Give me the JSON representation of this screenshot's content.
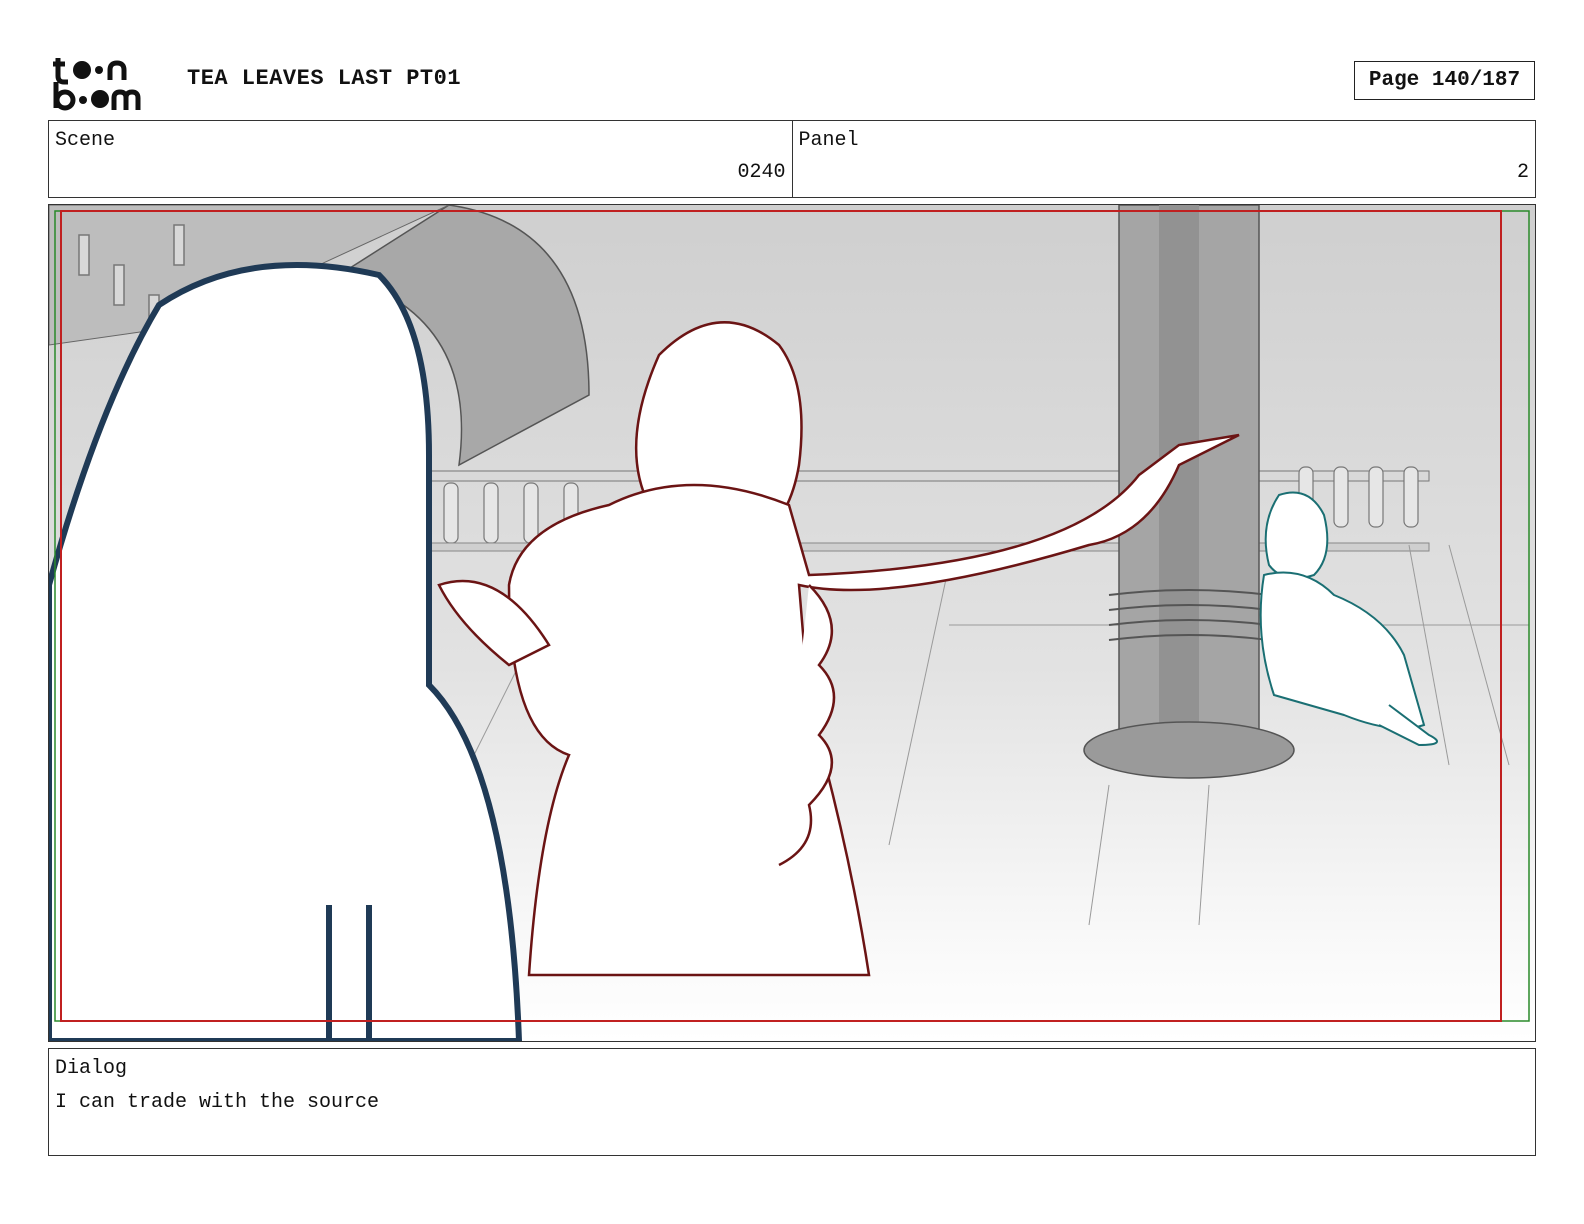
{
  "header": {
    "logo_text": "toon boom",
    "title": "TEA LEAVES LAST PT01",
    "page_label": "Page 140/187"
  },
  "scene": {
    "label": "Scene",
    "value": "0240"
  },
  "panel": {
    "label": "Panel",
    "value": "2"
  },
  "image": {
    "description_icon": "storyboard-sketch",
    "colors": {
      "hooded_figure": "#1f3a56",
      "woman": "#6b1414",
      "girl": "#1a6f73",
      "safe_frame": "#c02020",
      "title_frame": "#2a8a2a"
    }
  },
  "dialog": {
    "label": "Dialog",
    "text": "I can trade with the source"
  }
}
